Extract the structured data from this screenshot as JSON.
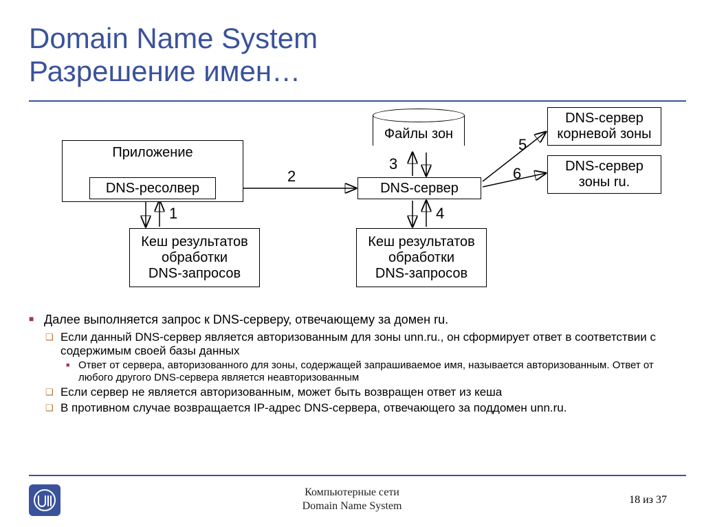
{
  "title": {
    "line1": "Domain Name System",
    "line2": "Разрешение имен…"
  },
  "diagram": {
    "app_outer": "Приложение",
    "app_inner": "DNS-ресолвер",
    "dns_server": "DNS-сервер",
    "zone_files": "Файлы зон",
    "cache1_l1": "Кеш результатов",
    "cache1_l2": "обработки",
    "cache1_l3": "DNS-запросов",
    "cache2_l1": "Кеш результатов",
    "cache2_l2": "обработки",
    "cache2_l3": "DNS-запросов",
    "root_l1": "DNS-сервер",
    "root_l2": "корневой зоны",
    "ru_l1": "DNS-сервер",
    "ru_l2": "зоны ru.",
    "n1": "1",
    "n2": "2",
    "n3": "3",
    "n4": "4",
    "n5": "5",
    "n6": "6"
  },
  "bullets": {
    "b1": "Далее выполняется запрос к DNS-серверу, отвечающему за домен ru.",
    "b2a": "Если данный DNS-сервер является авторизованным для зоны unn.ru., он сформирует ответ в соответствии с содержимым своей базы данных",
    "b3": "Ответ от сервера, авторизованного для зоны, содержащей запрашиваемое имя, называется авторизованным. Ответ от любого другого DNS-сервера является неавторизованным",
    "b2b": "Если сервер не является авторизованным, может быть возвращен ответ из кеша",
    "b2c": "В противном случае возвращается IP-адрес DNS-сервера, отвечающего за поддомен unn.ru."
  },
  "footer": {
    "center_l1": "Компьютерные сети",
    "center_l2": "Domain Name System",
    "page_cur": "18",
    "page_of": "из",
    "page_total": "37"
  }
}
